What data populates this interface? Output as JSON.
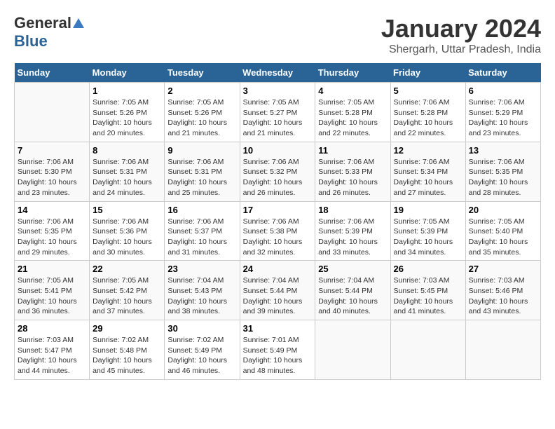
{
  "header": {
    "logo_general": "General",
    "logo_blue": "Blue",
    "title": "January 2024",
    "subtitle": "Shergarh, Uttar Pradesh, India"
  },
  "calendar": {
    "days_of_week": [
      "Sunday",
      "Monday",
      "Tuesday",
      "Wednesday",
      "Thursday",
      "Friday",
      "Saturday"
    ],
    "weeks": [
      [
        {
          "day": "",
          "sunrise": "",
          "sunset": "",
          "daylight": ""
        },
        {
          "day": "1",
          "sunrise": "Sunrise: 7:05 AM",
          "sunset": "Sunset: 5:26 PM",
          "daylight": "Daylight: 10 hours and 20 minutes."
        },
        {
          "day": "2",
          "sunrise": "Sunrise: 7:05 AM",
          "sunset": "Sunset: 5:26 PM",
          "daylight": "Daylight: 10 hours and 21 minutes."
        },
        {
          "day": "3",
          "sunrise": "Sunrise: 7:05 AM",
          "sunset": "Sunset: 5:27 PM",
          "daylight": "Daylight: 10 hours and 21 minutes."
        },
        {
          "day": "4",
          "sunrise": "Sunrise: 7:05 AM",
          "sunset": "Sunset: 5:28 PM",
          "daylight": "Daylight: 10 hours and 22 minutes."
        },
        {
          "day": "5",
          "sunrise": "Sunrise: 7:06 AM",
          "sunset": "Sunset: 5:28 PM",
          "daylight": "Daylight: 10 hours and 22 minutes."
        },
        {
          "day": "6",
          "sunrise": "Sunrise: 7:06 AM",
          "sunset": "Sunset: 5:29 PM",
          "daylight": "Daylight: 10 hours and 23 minutes."
        }
      ],
      [
        {
          "day": "7",
          "sunrise": "Sunrise: 7:06 AM",
          "sunset": "Sunset: 5:30 PM",
          "daylight": "Daylight: 10 hours and 23 minutes."
        },
        {
          "day": "8",
          "sunrise": "Sunrise: 7:06 AM",
          "sunset": "Sunset: 5:31 PM",
          "daylight": "Daylight: 10 hours and 24 minutes."
        },
        {
          "day": "9",
          "sunrise": "Sunrise: 7:06 AM",
          "sunset": "Sunset: 5:31 PM",
          "daylight": "Daylight: 10 hours and 25 minutes."
        },
        {
          "day": "10",
          "sunrise": "Sunrise: 7:06 AM",
          "sunset": "Sunset: 5:32 PM",
          "daylight": "Daylight: 10 hours and 26 minutes."
        },
        {
          "day": "11",
          "sunrise": "Sunrise: 7:06 AM",
          "sunset": "Sunset: 5:33 PM",
          "daylight": "Daylight: 10 hours and 26 minutes."
        },
        {
          "day": "12",
          "sunrise": "Sunrise: 7:06 AM",
          "sunset": "Sunset: 5:34 PM",
          "daylight": "Daylight: 10 hours and 27 minutes."
        },
        {
          "day": "13",
          "sunrise": "Sunrise: 7:06 AM",
          "sunset": "Sunset: 5:35 PM",
          "daylight": "Daylight: 10 hours and 28 minutes."
        }
      ],
      [
        {
          "day": "14",
          "sunrise": "Sunrise: 7:06 AM",
          "sunset": "Sunset: 5:35 PM",
          "daylight": "Daylight: 10 hours and 29 minutes."
        },
        {
          "day": "15",
          "sunrise": "Sunrise: 7:06 AM",
          "sunset": "Sunset: 5:36 PM",
          "daylight": "Daylight: 10 hours and 30 minutes."
        },
        {
          "day": "16",
          "sunrise": "Sunrise: 7:06 AM",
          "sunset": "Sunset: 5:37 PM",
          "daylight": "Daylight: 10 hours and 31 minutes."
        },
        {
          "day": "17",
          "sunrise": "Sunrise: 7:06 AM",
          "sunset": "Sunset: 5:38 PM",
          "daylight": "Daylight: 10 hours and 32 minutes."
        },
        {
          "day": "18",
          "sunrise": "Sunrise: 7:06 AM",
          "sunset": "Sunset: 5:39 PM",
          "daylight": "Daylight: 10 hours and 33 minutes."
        },
        {
          "day": "19",
          "sunrise": "Sunrise: 7:05 AM",
          "sunset": "Sunset: 5:39 PM",
          "daylight": "Daylight: 10 hours and 34 minutes."
        },
        {
          "day": "20",
          "sunrise": "Sunrise: 7:05 AM",
          "sunset": "Sunset: 5:40 PM",
          "daylight": "Daylight: 10 hours and 35 minutes."
        }
      ],
      [
        {
          "day": "21",
          "sunrise": "Sunrise: 7:05 AM",
          "sunset": "Sunset: 5:41 PM",
          "daylight": "Daylight: 10 hours and 36 minutes."
        },
        {
          "day": "22",
          "sunrise": "Sunrise: 7:05 AM",
          "sunset": "Sunset: 5:42 PM",
          "daylight": "Daylight: 10 hours and 37 minutes."
        },
        {
          "day": "23",
          "sunrise": "Sunrise: 7:04 AM",
          "sunset": "Sunset: 5:43 PM",
          "daylight": "Daylight: 10 hours and 38 minutes."
        },
        {
          "day": "24",
          "sunrise": "Sunrise: 7:04 AM",
          "sunset": "Sunset: 5:44 PM",
          "daylight": "Daylight: 10 hours and 39 minutes."
        },
        {
          "day": "25",
          "sunrise": "Sunrise: 7:04 AM",
          "sunset": "Sunset: 5:44 PM",
          "daylight": "Daylight: 10 hours and 40 minutes."
        },
        {
          "day": "26",
          "sunrise": "Sunrise: 7:03 AM",
          "sunset": "Sunset: 5:45 PM",
          "daylight": "Daylight: 10 hours and 41 minutes."
        },
        {
          "day": "27",
          "sunrise": "Sunrise: 7:03 AM",
          "sunset": "Sunset: 5:46 PM",
          "daylight": "Daylight: 10 hours and 43 minutes."
        }
      ],
      [
        {
          "day": "28",
          "sunrise": "Sunrise: 7:03 AM",
          "sunset": "Sunset: 5:47 PM",
          "daylight": "Daylight: 10 hours and 44 minutes."
        },
        {
          "day": "29",
          "sunrise": "Sunrise: 7:02 AM",
          "sunset": "Sunset: 5:48 PM",
          "daylight": "Daylight: 10 hours and 45 minutes."
        },
        {
          "day": "30",
          "sunrise": "Sunrise: 7:02 AM",
          "sunset": "Sunset: 5:49 PM",
          "daylight": "Daylight: 10 hours and 46 minutes."
        },
        {
          "day": "31",
          "sunrise": "Sunrise: 7:01 AM",
          "sunset": "Sunset: 5:49 PM",
          "daylight": "Daylight: 10 hours and 48 minutes."
        },
        {
          "day": "",
          "sunrise": "",
          "sunset": "",
          "daylight": ""
        },
        {
          "day": "",
          "sunrise": "",
          "sunset": "",
          "daylight": ""
        },
        {
          "day": "",
          "sunrise": "",
          "sunset": "",
          "daylight": ""
        }
      ]
    ]
  }
}
